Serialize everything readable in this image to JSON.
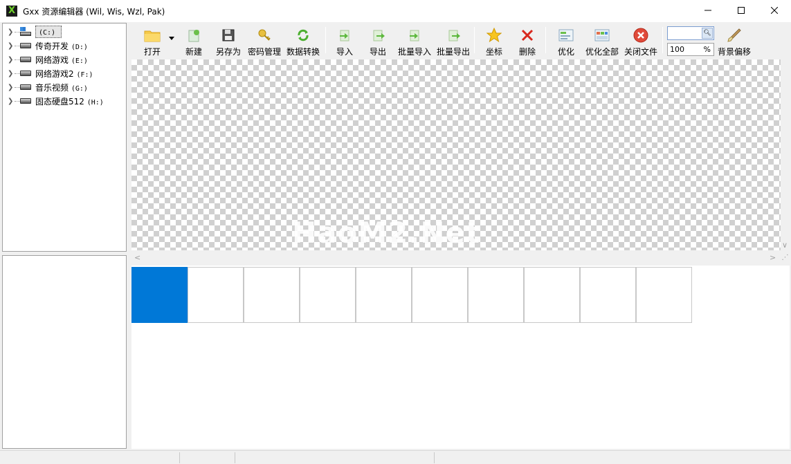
{
  "window": {
    "title": "Gxx 资源编辑器 (Wil, Wis, Wzl, Pak)",
    "app_icon_letter": "X",
    "controls": [
      "minimize",
      "maximize",
      "close"
    ]
  },
  "tree": {
    "items": [
      {
        "label": "",
        "letter": "(C:)",
        "icon": "system-drive-icon",
        "selected": true
      },
      {
        "label": "传奇开发",
        "letter": "(D:)",
        "icon": "hard-drive-icon",
        "selected": false
      },
      {
        "label": "网络游戏",
        "letter": "(E:)",
        "icon": "hard-drive-icon",
        "selected": false
      },
      {
        "label": "网络游戏2",
        "letter": "(F:)",
        "icon": "hard-drive-icon",
        "selected": false
      },
      {
        "label": "音乐视频",
        "letter": "(G:)",
        "icon": "hard-drive-icon",
        "selected": false
      },
      {
        "label": "固态硬盘512",
        "letter": "(H:)",
        "icon": "hard-drive-icon",
        "selected": false
      }
    ]
  },
  "toolbar": {
    "open": "打开",
    "new": "新建",
    "save_as": "另存为",
    "password": "密码管理",
    "convert": "数据转换",
    "import": "导入",
    "export": "导出",
    "batch_import": "批量导入",
    "batch_export": "批量导出",
    "coords": "坐标",
    "delete": "删除",
    "optimize": "优化",
    "optimize_all": "优化全部",
    "close_file": "关闭文件",
    "bg_offset": "背景偏移",
    "search_value": "",
    "zoom_value": "100",
    "zoom_unit": "%"
  },
  "canvas": {
    "watermark": "HaoM2.Net"
  },
  "thumbnails": {
    "count": 10,
    "selected_index": 0
  },
  "colors": {
    "selection": "#0078d7",
    "checker": "#d0d0d0"
  }
}
